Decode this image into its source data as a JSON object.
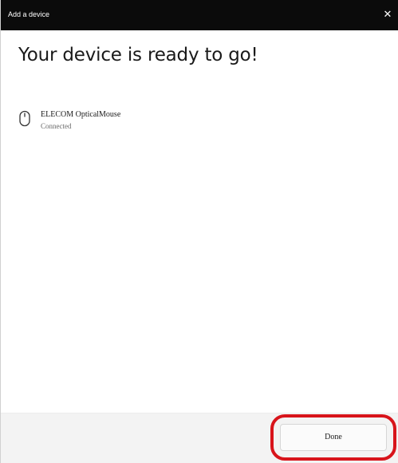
{
  "window": {
    "title": "Add a device",
    "close_glyph": "✕"
  },
  "main": {
    "heading": "Your device is ready to go!",
    "devices": [
      {
        "name": "ELECOM OpticalMouse",
        "status": "Connected",
        "icon": "mouse-icon"
      }
    ]
  },
  "footer": {
    "done_label": "Done",
    "highlight_color": "#d8141b"
  }
}
